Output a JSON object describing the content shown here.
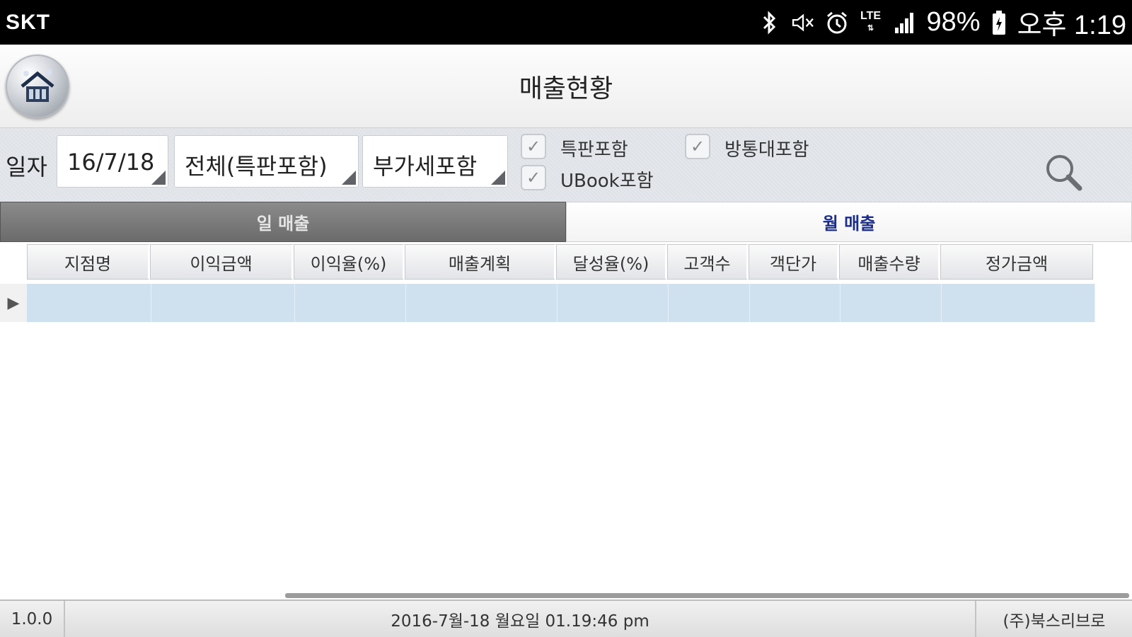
{
  "status_bar": {
    "carrier": "SKT",
    "network": "LTE",
    "battery": "98%",
    "time": "오후 1:19",
    "icons": [
      "bluetooth-icon",
      "mute-icon",
      "alarm-icon",
      "lte-icon",
      "signal-icon",
      "battery-icon"
    ]
  },
  "header": {
    "title": "매출현황",
    "home_icon": "home-icon"
  },
  "filters": {
    "date_label": "일자",
    "date_value": "16/7/18",
    "scope_value": "전체(특판포함)",
    "tax_value": "부가세포함",
    "checkboxes": [
      {
        "label": "특판포함",
        "checked": true
      },
      {
        "label": "방통대포함",
        "checked": true
      },
      {
        "label": "UBook포함",
        "checked": true
      }
    ],
    "search_icon": "search-icon"
  },
  "tabs": [
    {
      "label": "일 매출",
      "active": true
    },
    {
      "label": "월 매출",
      "active": false
    }
  ],
  "grid": {
    "columns": [
      "지점명",
      "이익금액",
      "이익율(%)",
      "매출계획",
      "달성율(%)",
      "고객수",
      "객단가",
      "매출수량",
      "정가금액"
    ],
    "rows": [
      [
        "",
        "",
        "",
        "",
        "",
        "",
        "",
        "",
        ""
      ]
    ]
  },
  "footer": {
    "version": "1.0.0",
    "datetime": "2016-7월-18 월요일 01.19:46 pm",
    "company": "(주)북스리브로"
  },
  "colors": {
    "selected_row": "#cfe0ee",
    "active_tab": "#7a7a7a",
    "inactive_tab_text": "#1a2d8a"
  }
}
